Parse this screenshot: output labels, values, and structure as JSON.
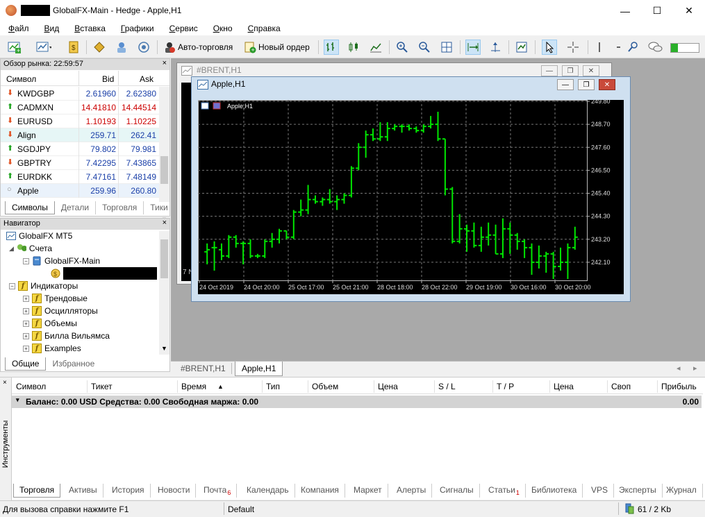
{
  "window": {
    "title": "GlobalFX-Main - Hedge - Apple,H1",
    "controls": {
      "minimize": "—",
      "maximize": "☐",
      "close": "✕"
    }
  },
  "menu": [
    "Файл",
    "Вид",
    "Вставка",
    "Графики",
    "Сервис",
    "Окно",
    "Справка"
  ],
  "toolbar": {
    "autotrading_label": "Авто-торговля",
    "new_order_label": "Новый ордер"
  },
  "market_watch": {
    "title": "Обзор рынка: 22:59:57",
    "close": "×",
    "columns": {
      "symbol": "Символ",
      "bid": "Bid",
      "ask": "Ask"
    },
    "rows": [
      {
        "symbol": "KWDGBP",
        "bid": "2.61960",
        "ask": "2.62380",
        "dir": "down",
        "color": "#1a3fa8",
        "arrow": "⬇"
      },
      {
        "symbol": "CADMXN",
        "bid": "14.41810",
        "ask": "14.44514",
        "dir": "up",
        "color": "#cc0000",
        "arrow": "⬆"
      },
      {
        "symbol": "EURUSD",
        "bid": "1.10193",
        "ask": "1.10225",
        "dir": "down",
        "color": "#cc0000",
        "arrow": "⬇"
      },
      {
        "symbol": "Align",
        "bid": "259.71",
        "ask": "262.41",
        "dir": "down",
        "color": "#1a3fa8",
        "arrow": "⬇"
      },
      {
        "symbol": "SGDJPY",
        "bid": "79.802",
        "ask": "79.981",
        "dir": "up",
        "color": "#1a3fa8",
        "arrow": "⬆"
      },
      {
        "symbol": "GBPTRY",
        "bid": "7.42295",
        "ask": "7.43865",
        "dir": "down",
        "color": "#1a3fa8",
        "arrow": "⬇"
      },
      {
        "symbol": "EURDKK",
        "bid": "7.47161",
        "ask": "7.48149",
        "dir": "up",
        "color": "#1a3fa8",
        "arrow": "⬆"
      },
      {
        "symbol": "Apple",
        "bid": "259.96",
        "ask": "260.80",
        "dir": "none",
        "color": "#1a3fa8",
        "arrow": "○"
      }
    ],
    "tabs": [
      "Символы",
      "Детали",
      "Торговля",
      "Тики"
    ]
  },
  "navigator": {
    "title": "Навигатор",
    "close": "×",
    "root": "GlobalFX MT5",
    "accounts": "Счета",
    "account_name": "GlobalFX-Main",
    "indicators": "Индикаторы",
    "indicator_groups": [
      "Трендовые",
      "Осцилляторы",
      "Объемы",
      "Билла Вильямса",
      "Examples"
    ],
    "tabs": [
      "Общие",
      "Избранное"
    ]
  },
  "charts": {
    "back_window_title": "#BRENT,H1",
    "back_window_partial_label": "7 N",
    "front_window_title": "Apple,H1",
    "front_inner_label": "Apple,H1",
    "tabs": [
      "#BRENT,H1",
      "Apple,H1"
    ],
    "scroll_left": "◂",
    "scroll_right": "▸"
  },
  "chart_data": {
    "type": "ohlc",
    "title": "Apple,H1",
    "ylim": [
      241.3,
      249.8
    ],
    "y_ticks": [
      "249.80",
      "248.70",
      "247.60",
      "246.50",
      "245.40",
      "244.30",
      "243.20",
      "242.10"
    ],
    "x_ticks": [
      "24 Oct 2019",
      "24 Oct 20:00",
      "25 Oct 17:00",
      "25 Oct 21:00",
      "28 Oct 18:00",
      "28 Oct 22:00",
      "29 Oct 19:00",
      "30 Oct 16:00",
      "30 Oct 20:00"
    ],
    "bars": [
      {
        "o": 242.6,
        "h": 243.0,
        "l": 242.0,
        "c": 242.7
      },
      {
        "o": 242.8,
        "h": 243.1,
        "l": 241.7,
        "c": 242.8
      },
      {
        "o": 242.7,
        "h": 243.0,
        "l": 242.2,
        "c": 242.4
      },
      {
        "o": 242.4,
        "h": 243.4,
        "l": 242.3,
        "c": 243.3
      },
      {
        "o": 243.3,
        "h": 243.4,
        "l": 242.8,
        "c": 243.0
      },
      {
        "o": 243.0,
        "h": 243.1,
        "l": 242.0,
        "c": 243.0
      },
      {
        "o": 243.0,
        "h": 243.2,
        "l": 242.3,
        "c": 242.4
      },
      {
        "o": 242.4,
        "h": 242.5,
        "l": 242.3,
        "c": 242.4
      },
      {
        "o": 242.4,
        "h": 243.2,
        "l": 242.3,
        "c": 243.1
      },
      {
        "o": 243.1,
        "h": 243.5,
        "l": 242.8,
        "c": 243.2
      },
      {
        "o": 243.2,
        "h": 243.7,
        "l": 243.0,
        "c": 243.6
      },
      {
        "o": 243.6,
        "h": 243.6,
        "l": 243.2,
        "c": 243.3
      },
      {
        "o": 243.3,
        "h": 244.6,
        "l": 243.2,
        "c": 244.5
      },
      {
        "o": 244.5,
        "h": 245.1,
        "l": 244.3,
        "c": 244.6
      },
      {
        "o": 244.6,
        "h": 245.8,
        "l": 244.4,
        "c": 245.1
      },
      {
        "o": 245.1,
        "h": 245.3,
        "l": 244.9,
        "c": 245.0
      },
      {
        "o": 245.0,
        "h": 245.2,
        "l": 244.8,
        "c": 245.1
      },
      {
        "o": 245.1,
        "h": 245.6,
        "l": 244.9,
        "c": 245.0
      },
      {
        "o": 245.0,
        "h": 245.3,
        "l": 244.6,
        "c": 245.1
      },
      {
        "o": 245.1,
        "h": 245.4,
        "l": 244.9,
        "c": 245.3
      },
      {
        "o": 245.3,
        "h": 246.7,
        "l": 245.2,
        "c": 246.6
      },
      {
        "o": 246.6,
        "h": 247.8,
        "l": 246.5,
        "c": 247.6
      },
      {
        "o": 247.6,
        "h": 248.4,
        "l": 247.1,
        "c": 248.2
      },
      {
        "o": 248.2,
        "h": 248.5,
        "l": 247.9,
        "c": 248.0
      },
      {
        "o": 248.0,
        "h": 248.8,
        "l": 247.9,
        "c": 248.1
      },
      {
        "o": 248.1,
        "h": 248.8,
        "l": 247.9,
        "c": 248.5
      },
      {
        "o": 248.5,
        "h": 248.7,
        "l": 248.4,
        "c": 248.6
      },
      {
        "o": 248.6,
        "h": 248.7,
        "l": 248.3,
        "c": 248.6
      },
      {
        "o": 248.6,
        "h": 248.7,
        "l": 248.4,
        "c": 248.5
      },
      {
        "o": 248.5,
        "h": 248.6,
        "l": 248.3,
        "c": 248.4
      },
      {
        "o": 248.4,
        "h": 248.7,
        "l": 248.3,
        "c": 248.6
      },
      {
        "o": 248.6,
        "h": 249.1,
        "l": 248.5,
        "c": 248.7
      },
      {
        "o": 248.7,
        "h": 249.3,
        "l": 247.9,
        "c": 248.0
      },
      {
        "o": 248.0,
        "h": 248.0,
        "l": 245.3,
        "c": 245.6
      },
      {
        "o": 245.6,
        "h": 245.7,
        "l": 243.0,
        "c": 243.1
      },
      {
        "o": 243.1,
        "h": 244.4,
        "l": 243.0,
        "c": 243.7
      },
      {
        "o": 243.7,
        "h": 243.9,
        "l": 242.6,
        "c": 243.6
      },
      {
        "o": 243.6,
        "h": 244.0,
        "l": 242.8,
        "c": 242.9
      },
      {
        "o": 242.9,
        "h": 243.8,
        "l": 242.6,
        "c": 243.3
      },
      {
        "o": 243.3,
        "h": 244.0,
        "l": 242.9,
        "c": 243.4
      },
      {
        "o": 243.4,
        "h": 243.9,
        "l": 242.5,
        "c": 242.5
      },
      {
        "o": 242.5,
        "h": 244.2,
        "l": 242.3,
        "c": 243.7
      },
      {
        "o": 243.7,
        "h": 244.0,
        "l": 242.5,
        "c": 243.4
      },
      {
        "o": 243.4,
        "h": 243.5,
        "l": 242.7,
        "c": 243.1
      },
      {
        "o": 243.1,
        "h": 243.2,
        "l": 242.3,
        "c": 242.8
      },
      {
        "o": 242.8,
        "h": 243.0,
        "l": 241.5,
        "c": 242.1
      },
      {
        "o": 242.1,
        "h": 242.9,
        "l": 241.8,
        "c": 242.4
      },
      {
        "o": 242.4,
        "h": 242.6,
        "l": 241.6,
        "c": 242.5
      },
      {
        "o": 242.5,
        "h": 242.6,
        "l": 241.3,
        "c": 241.9
      },
      {
        "o": 241.9,
        "h": 242.8,
        "l": 241.7,
        "c": 242.1
      },
      {
        "o": 242.1,
        "h": 243.0,
        "l": 241.3,
        "c": 242.8
      },
      {
        "o": 242.8,
        "h": 243.8,
        "l": 242.7,
        "c": 243.3
      }
    ],
    "bar_color": "#00e600",
    "background": "#000000",
    "grid": true
  },
  "toolbox": {
    "side_label": "Инструменты",
    "columns": [
      "Символ",
      "Тикет",
      "Время",
      "Тип",
      "Объем",
      "Цена",
      "S / L",
      "T / P",
      "Цена",
      "Своп",
      "Прибыль"
    ],
    "sort_arrow": "▲",
    "balance_text": "Баланс: 0.00 USD  Средства: 0.00  Свободная маржа: 0.00",
    "balance_profit": "0.00",
    "tabs": [
      {
        "label": "Торговля",
        "badge": ""
      },
      {
        "label": "Активы",
        "badge": ""
      },
      {
        "label": "История",
        "badge": ""
      },
      {
        "label": "Новости",
        "badge": ""
      },
      {
        "label": "Почта",
        "badge": "6"
      },
      {
        "label": "Календарь",
        "badge": ""
      },
      {
        "label": "Компания",
        "badge": ""
      },
      {
        "label": "Маркет",
        "badge": ""
      },
      {
        "label": "Алерты",
        "badge": ""
      },
      {
        "label": "Сигналы",
        "badge": ""
      },
      {
        "label": "Статьи",
        "badge": "1"
      },
      {
        "label": "Библиотека",
        "badge": ""
      },
      {
        "label": "VPS",
        "badge": ""
      },
      {
        "label": "Эксперты",
        "badge": ""
      },
      {
        "label": "Журнал",
        "badge": ""
      }
    ]
  },
  "statusbar": {
    "help": "Для вызова справки нажмите F1",
    "profile": "Default",
    "traffic": "61 / 2 Kb"
  },
  "colors": {
    "accent": "#0078d7",
    "up": "#1fa31f",
    "down": "#e05020",
    "badge": "#d00000"
  }
}
